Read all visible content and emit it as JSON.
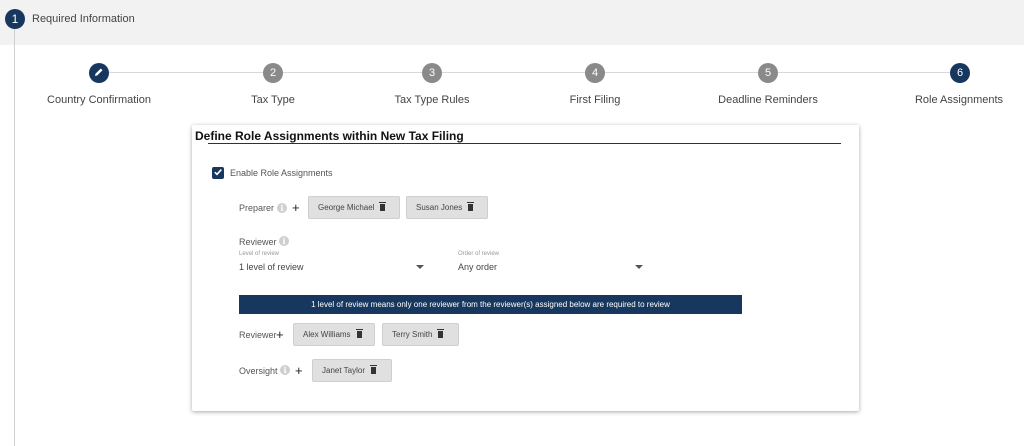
{
  "header": {
    "step_number": "1",
    "title": "Required Information"
  },
  "stepper": {
    "steps": [
      {
        "number": "",
        "label": "Country Confirmation",
        "icon": "pencil-icon",
        "state": "active"
      },
      {
        "number": "2",
        "label": "Tax Type",
        "state": "inactive"
      },
      {
        "number": "3",
        "label": "Tax Type Rules",
        "state": "inactive"
      },
      {
        "number": "4",
        "label": "First Filing",
        "state": "inactive"
      },
      {
        "number": "5",
        "label": "Deadline Reminders",
        "state": "inactive"
      },
      {
        "number": "6",
        "label": "Role Assignments",
        "state": "active"
      }
    ]
  },
  "card": {
    "title": "Define Role Assignments within New Tax Filing",
    "enable_checkbox": {
      "label": "Enable Role Assignments",
      "checked": true
    },
    "preparer": {
      "label": "Preparer",
      "chips": [
        "George Michael",
        "Susan Jones"
      ]
    },
    "reviewer_section": {
      "label": "Reviewer",
      "level_field": {
        "label": "Level of review",
        "value": "1 level of review"
      },
      "order_field": {
        "label": "Order of review",
        "value": "Any order"
      }
    },
    "banner": "1 level of review means only one reviewer from the reviewer(s) assigned below are required to review",
    "reviewer": {
      "label": "Reviewer",
      "chips": [
        "Alex Williams",
        "Terry Smith"
      ]
    },
    "oversight": {
      "label": "Oversight",
      "chips": [
        "Janet Taylor"
      ]
    }
  },
  "colors": {
    "primary": "#17375e",
    "step_inactive": "#8a8a8a",
    "chip_bg": "#e0e0e0"
  }
}
